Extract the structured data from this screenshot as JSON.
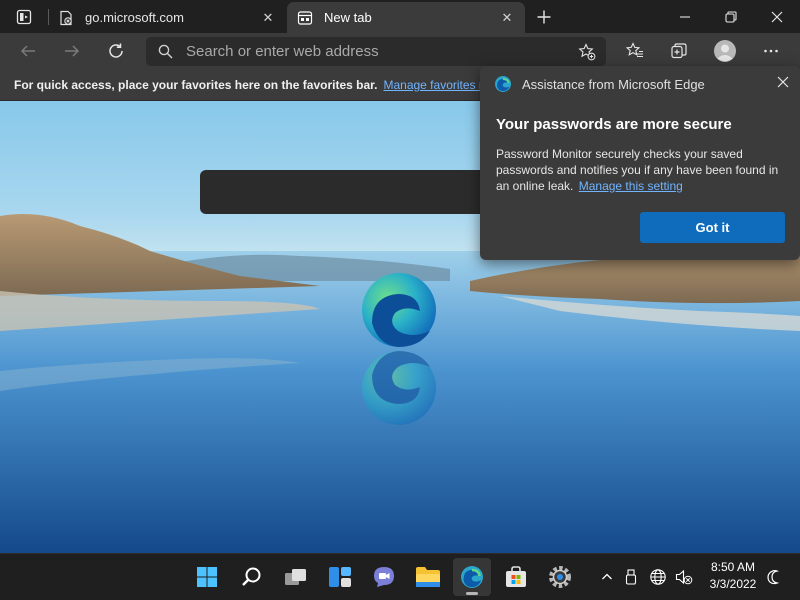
{
  "tabs": [
    {
      "title": "go.microsoft.com",
      "active": false
    },
    {
      "title": "New tab",
      "active": true
    }
  ],
  "address_bar": {
    "placeholder": "Search or enter web address",
    "value": ""
  },
  "favorites_bar": {
    "message": "For quick access, place your favorites here on the favorites bar.",
    "link": "Manage favorites now"
  },
  "popup": {
    "header": "Assistance from Microsoft Edge",
    "title": "Your passwords are more secure",
    "body": "Password Monitor securely checks your saved passwords and notifies you if any have been found in an online leak.",
    "link": "Manage this setting",
    "button": "Got it"
  },
  "taskbar": {
    "apps": [
      "start-icon",
      "search-icon",
      "task-view-icon",
      "widgets-icon",
      "teams-chat-icon",
      "file-explorer-icon",
      "edge-icon",
      "store-icon",
      "settings-icon"
    ],
    "tray": [
      "chevron-up-icon",
      "usb-icon",
      "globe-icon",
      "volume-muted-icon"
    ],
    "time": "8:50 AM",
    "date": "3/3/2022"
  },
  "colors": {
    "accent": "#0f6cbd",
    "link": "#71b4ff",
    "toolbar": "#3b3b3b",
    "frame": "#202020"
  }
}
